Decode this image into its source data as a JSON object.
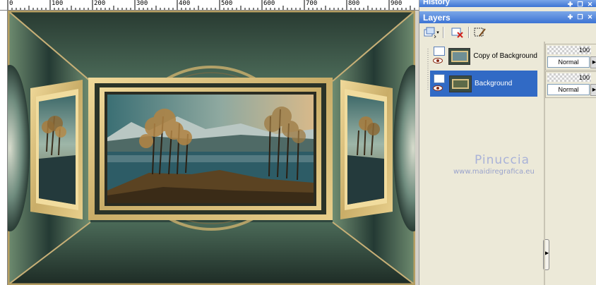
{
  "ruler": {
    "labels": [
      "0",
      "100",
      "200",
      "300",
      "400",
      "500",
      "600",
      "700",
      "800",
      "900"
    ]
  },
  "canvas": {
    "content": "layered frame artwork of an autumn lakeside landscape",
    "colors": {
      "gold": "#d8c184",
      "dark_teal": "#2b3b35",
      "sky_teal": "#4e7b78",
      "water": "#2d5c66"
    }
  },
  "panels": {
    "history": {
      "title": "History"
    },
    "layers": {
      "title": "Layers",
      "toolbar": [
        {
          "name": "new-layer-icon"
        },
        {
          "name": "delete-layer-icon"
        },
        {
          "name": "edit-mask-icon"
        }
      ],
      "items": [
        {
          "name": "Copy of Background",
          "opacity": "100",
          "blend": "Normal",
          "selected": false
        },
        {
          "name": "Background",
          "opacity": "100",
          "blend": "Normal",
          "selected": true
        }
      ],
      "watermark": {
        "title": "Pinuccia",
        "url": "www.maidiregrafica.eu"
      }
    }
  },
  "colors": {
    "panel_bg": "#ece9d8",
    "title_bar": "#3d74d4",
    "selection": "#316ac5"
  }
}
